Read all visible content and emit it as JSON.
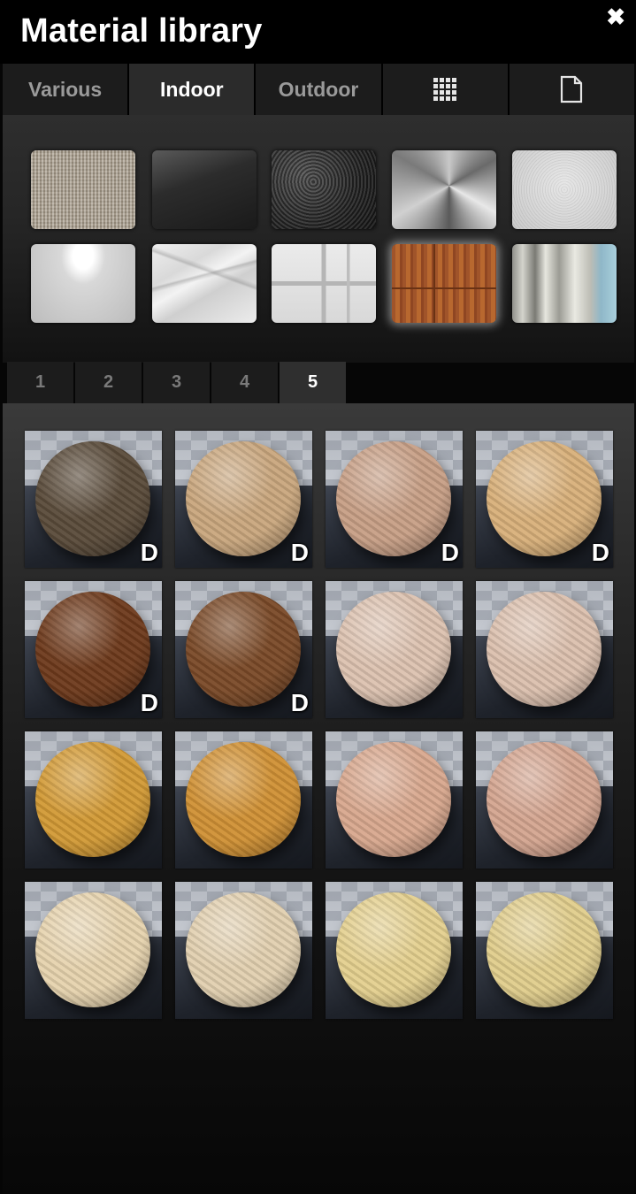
{
  "window": {
    "title": "Material library",
    "close_glyph": "✖"
  },
  "category_tabs": [
    {
      "label": "Various",
      "active": false
    },
    {
      "label": "Indoor",
      "active": true
    },
    {
      "label": "Outdoor",
      "active": false
    },
    {
      "label": "",
      "icon": "grid-icon"
    },
    {
      "label": "",
      "icon": "file-icon"
    }
  ],
  "featured": [
    {
      "name": "fabric",
      "selected": false
    },
    {
      "name": "glossy-black",
      "selected": false
    },
    {
      "name": "black-leather",
      "selected": false
    },
    {
      "name": "brushed-metal",
      "selected": false
    },
    {
      "name": "white-plaster",
      "selected": false
    },
    {
      "name": "white-gloss",
      "selected": false
    },
    {
      "name": "marble",
      "selected": false
    },
    {
      "name": "white-tiles",
      "selected": false
    },
    {
      "name": "wood-floor",
      "selected": true
    },
    {
      "name": "curtain",
      "selected": false
    }
  ],
  "page_tabs": [
    {
      "label": "1",
      "active": false
    },
    {
      "label": "2",
      "active": false
    },
    {
      "label": "3",
      "active": false
    },
    {
      "label": "4",
      "active": false
    },
    {
      "label": "5",
      "active": true
    }
  ],
  "materials": [
    {
      "color": "#5a4b3a",
      "badge": "D"
    },
    {
      "color": "#c9a77e",
      "badge": "D"
    },
    {
      "color": "#c79f86",
      "badge": "D"
    },
    {
      "color": "#d8b07a",
      "badge": "D"
    },
    {
      "color": "#6e3a1c",
      "badge": "D"
    },
    {
      "color": "#7a4a28",
      "badge": "D"
    },
    {
      "color": "#dcc2b0",
      "badge": ""
    },
    {
      "color": "#dbc0ae",
      "badge": ""
    },
    {
      "color": "#d29a36",
      "badge": ""
    },
    {
      "color": "#d09135",
      "badge": ""
    },
    {
      "color": "#d8a88e",
      "badge": ""
    },
    {
      "color": "#d4a590",
      "badge": ""
    },
    {
      "color": "#e6d3ae",
      "badge": ""
    },
    {
      "color": "#e2d0b0",
      "badge": ""
    },
    {
      "color": "#e4d08f",
      "badge": ""
    },
    {
      "color": "#e0cd8c",
      "badge": ""
    }
  ]
}
